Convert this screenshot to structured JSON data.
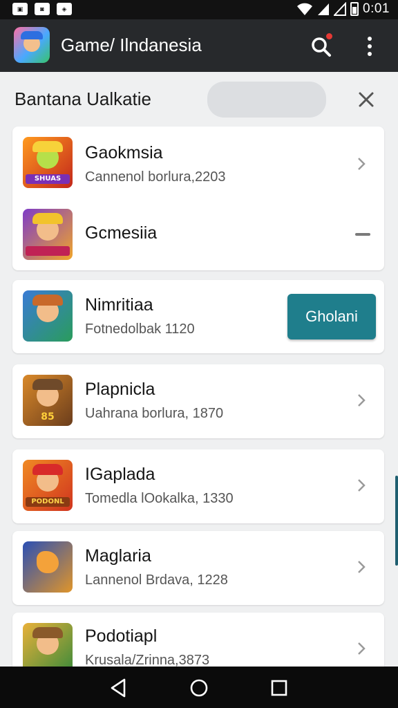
{
  "status_bar": {
    "time": "0:01",
    "left_icons": [
      "notification-icon-1",
      "notification-icon-2",
      "notification-icon-3"
    ],
    "right_icons": [
      "wifi-icon",
      "signal-icon",
      "signal-icon-2",
      "battery-icon"
    ]
  },
  "app_bar": {
    "title": "Game/ Ilndanesia",
    "logo_icon": "app-logo-icon",
    "search_icon": "search-icon",
    "menu_icon": "more-vert-icon"
  },
  "section": {
    "title": "Bantana Ualkatie",
    "close_icon": "close-icon"
  },
  "groups": [
    {
      "items": [
        {
          "title": "Gaokmsia",
          "subtitle": "Cannenol borlura,2203",
          "thumb_label": "SHUAS",
          "trailing": "chevron"
        },
        {
          "title": "Gcmesiia",
          "subtitle": "",
          "thumb_label": "",
          "trailing": "minus"
        }
      ]
    },
    {
      "items": [
        {
          "title": "Nimritiaa",
          "subtitle": "Fotnedolbak 1120",
          "thumb_label": "",
          "trailing": "button",
          "button_label": "Gholani"
        }
      ]
    },
    {
      "items": [
        {
          "title": "Plapnicla",
          "subtitle": "Uahrana borlura, 1870",
          "thumb_label": "85",
          "trailing": "chevron"
        }
      ]
    },
    {
      "items": [
        {
          "title": "IGaplada",
          "subtitle": "Tomedla lOokalka, 1330",
          "thumb_label": "PODONL",
          "trailing": "chevron"
        }
      ]
    },
    {
      "items": [
        {
          "title": "Maglaria",
          "subtitle": "Lannenol Brdava, 1228",
          "thumb_label": "",
          "trailing": "chevron"
        }
      ]
    },
    {
      "items": [
        {
          "title": "Podotiapl",
          "subtitle": "Krusala/Zrinna,3873",
          "thumb_label": "",
          "trailing": "chevron"
        }
      ]
    }
  ],
  "nav_bar": {
    "back_icon": "back-icon",
    "home_icon": "home-icon",
    "recents_icon": "recents-icon"
  },
  "colors": {
    "app_bar": "#27292c",
    "accent_button": "#1f7e8c",
    "background": "#eff0f1"
  }
}
